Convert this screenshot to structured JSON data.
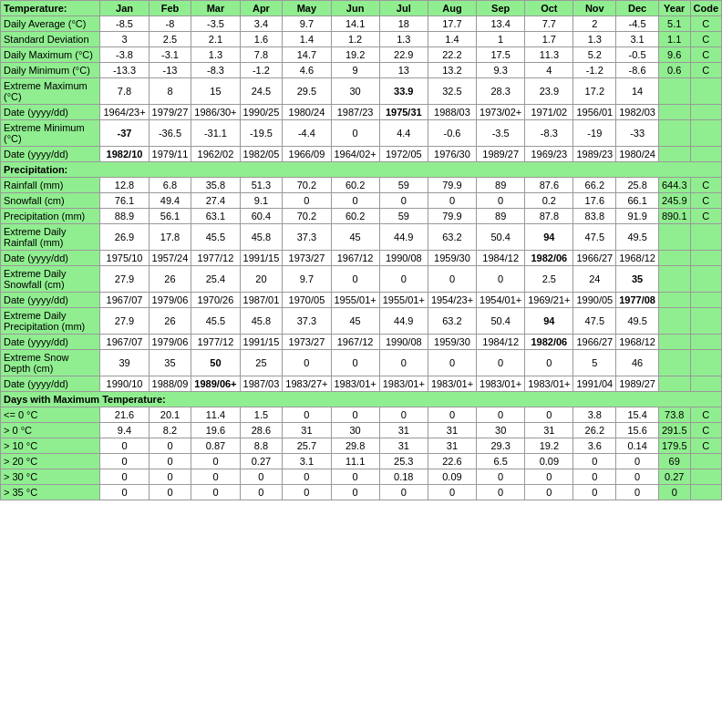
{
  "table": {
    "headers": [
      "Temperature:",
      "Jan",
      "Feb",
      "Mar",
      "Apr",
      "May",
      "Jun",
      "Jul",
      "Aug",
      "Sep",
      "Oct",
      "Nov",
      "Dec",
      "Year",
      "Code"
    ],
    "rows": [
      {
        "label": "Daily Average (°C)",
        "values": [
          "-8.5",
          "-8",
          "-3.5",
          "3.4",
          "9.7",
          "14.1",
          "18",
          "17.7",
          "13.4",
          "7.7",
          "2",
          "-4.5",
          "5.1",
          "C"
        ],
        "bold": []
      },
      {
        "label": "Standard Deviation",
        "values": [
          "3",
          "2.5",
          "2.1",
          "1.6",
          "1.4",
          "1.2",
          "1.3",
          "1.4",
          "1",
          "1.7",
          "1.3",
          "3.1",
          "1.1",
          "C"
        ],
        "bold": []
      },
      {
        "label": "Daily Maximum (°C)",
        "values": [
          "-3.8",
          "-3.1",
          "1.3",
          "7.8",
          "14.7",
          "19.2",
          "22.9",
          "22.2",
          "17.5",
          "11.3",
          "5.2",
          "-0.5",
          "9.6",
          "C"
        ],
        "bold": []
      },
      {
        "label": "Daily Minimum (°C)",
        "values": [
          "-13.3",
          "-13",
          "-8.3",
          "-1.2",
          "4.6",
          "9",
          "13",
          "13.2",
          "9.3",
          "4",
          "-1.2",
          "-8.6",
          "0.6",
          "C"
        ],
        "bold": []
      },
      {
        "label": "Extreme Maximum (°C)",
        "values": [
          "7.8",
          "8",
          "15",
          "24.5",
          "29.5",
          "30",
          "33.9",
          "32.5",
          "28.3",
          "23.9",
          "17.2",
          "14",
          "",
          ""
        ],
        "bold": [
          "33.9"
        ]
      },
      {
        "label": "Date (yyyy/dd)",
        "values": [
          "1964/23+",
          "1979/27",
          "1986/30+",
          "1990/25",
          "1980/24",
          "1987/23",
          "1975/31",
          "1988/03",
          "1973/02+",
          "1971/02",
          "1956/01",
          "1982/03",
          "",
          ""
        ],
        "bold": [
          "1975/31"
        ]
      },
      {
        "label": "Extreme Minimum (°C)",
        "values": [
          "-37",
          "-36.5",
          "-31.1",
          "-19.5",
          "-4.4",
          "0",
          "4.4",
          "-0.6",
          "-3.5",
          "-8.3",
          "-19",
          "-33",
          "",
          ""
        ],
        "bold": [
          "-37"
        ]
      },
      {
        "label": "Date (yyyy/dd)",
        "values": [
          "1982/10",
          "1979/11",
          "1962/02",
          "1982/05",
          "1966/09",
          "1964/02+",
          "1972/05",
          "1976/30",
          "1989/27",
          "1969/23",
          "1989/23",
          "1980/24",
          "",
          ""
        ],
        "bold": [
          "1982/10"
        ]
      },
      {
        "label": "Precipitation:",
        "section": true
      },
      {
        "label": "Rainfall (mm)",
        "values": [
          "12.8",
          "6.8",
          "35.8",
          "51.3",
          "70.2",
          "60.2",
          "59",
          "79.9",
          "89",
          "87.6",
          "66.2",
          "25.8",
          "644.3",
          "C"
        ],
        "bold": []
      },
      {
        "label": "Snowfall (cm)",
        "values": [
          "76.1",
          "49.4",
          "27.4",
          "9.1",
          "0",
          "0",
          "0",
          "0",
          "0",
          "0.2",
          "17.6",
          "66.1",
          "245.9",
          "C"
        ],
        "bold": []
      },
      {
        "label": "Precipitation (mm)",
        "values": [
          "88.9",
          "56.1",
          "63.1",
          "60.4",
          "70.2",
          "60.2",
          "59",
          "79.9",
          "89",
          "87.8",
          "83.8",
          "91.9",
          "890.1",
          "C"
        ],
        "bold": []
      },
      {
        "label": "Extreme Daily Rainfall (mm)",
        "values": [
          "26.9",
          "17.8",
          "45.5",
          "45.8",
          "37.3",
          "45",
          "44.9",
          "63.2",
          "50.4",
          "94",
          "47.5",
          "49.5",
          "",
          ""
        ],
        "bold": [
          "94"
        ]
      },
      {
        "label": "Date (yyyy/dd)",
        "values": [
          "1975/10",
          "1957/24",
          "1977/12",
          "1991/15",
          "1973/27",
          "1967/12",
          "1990/08",
          "1959/30",
          "1984/12",
          "1982/06",
          "1966/27",
          "1968/12",
          "",
          ""
        ],
        "bold": [
          "1982/06"
        ]
      },
      {
        "label": "Extreme Daily Snowfall (cm)",
        "values": [
          "27.9",
          "26",
          "25.4",
          "20",
          "9.7",
          "0",
          "0",
          "0",
          "0",
          "2.5",
          "24",
          "35",
          "",
          ""
        ],
        "bold": [
          "35"
        ]
      },
      {
        "label": "Date (yyyy/dd)",
        "values": [
          "1967/07",
          "1979/06",
          "1970/26",
          "1987/01",
          "1970/05",
          "1955/01+",
          "1955/01+",
          "1954/23+",
          "1954/01+",
          "1969/21+",
          "1990/05",
          "1977/08",
          "",
          ""
        ],
        "bold": [
          "1977/08"
        ]
      },
      {
        "label": "Extreme Daily Precipitation (mm)",
        "values": [
          "27.9",
          "26",
          "45.5",
          "45.8",
          "37.3",
          "45",
          "44.9",
          "63.2",
          "50.4",
          "94",
          "47.5",
          "49.5",
          "",
          ""
        ],
        "bold": [
          "94"
        ]
      },
      {
        "label": "Date (yyyy/dd)",
        "values": [
          "1967/07",
          "1979/06",
          "1977/12",
          "1991/15",
          "1973/27",
          "1967/12",
          "1990/08",
          "1959/30",
          "1984/12",
          "1982/06",
          "1966/27",
          "1968/12",
          "",
          ""
        ],
        "bold": [
          "1982/06"
        ]
      },
      {
        "label": "Extreme Snow Depth (cm)",
        "values": [
          "39",
          "35",
          "50",
          "25",
          "0",
          "0",
          "0",
          "0",
          "0",
          "0",
          "5",
          "46",
          "",
          ""
        ],
        "bold": [
          "50"
        ]
      },
      {
        "label": "Date (yyyy/dd)",
        "values": [
          "1990/10",
          "1988/09",
          "1989/06+",
          "1987/03",
          "1983/27+",
          "1983/01+",
          "1983/01+",
          "1983/01+",
          "1983/01+",
          "1983/01+",
          "1991/04",
          "1989/27",
          "",
          ""
        ],
        "bold": [
          "1989/06+"
        ]
      },
      {
        "label": "Days with Maximum Temperature:",
        "section": true
      },
      {
        "label": "<= 0 °C",
        "values": [
          "21.6",
          "20.1",
          "11.4",
          "1.5",
          "0",
          "0",
          "0",
          "0",
          "0",
          "0",
          "3.8",
          "15.4",
          "73.8",
          "C"
        ],
        "bold": []
      },
      {
        "label": "> 0 °C",
        "values": [
          "9.4",
          "8.2",
          "19.6",
          "28.6",
          "31",
          "30",
          "31",
          "31",
          "30",
          "31",
          "26.2",
          "15.6",
          "291.5",
          "C"
        ],
        "bold": []
      },
      {
        "label": "> 10 °C",
        "values": [
          "0",
          "0",
          "0.87",
          "8.8",
          "25.7",
          "29.8",
          "31",
          "31",
          "29.3",
          "19.2",
          "3.6",
          "0.14",
          "179.5",
          "C"
        ],
        "bold": []
      },
      {
        "label": "> 20 °C",
        "values": [
          "0",
          "0",
          "0",
          "0.27",
          "3.1",
          "11.1",
          "25.3",
          "22.6",
          "6.5",
          "0.09",
          "0",
          "0",
          "69",
          ""
        ],
        "bold": []
      },
      {
        "label": "> 30 °C",
        "values": [
          "0",
          "0",
          "0",
          "0",
          "0",
          "0",
          "0.18",
          "0.09",
          "0",
          "0",
          "0",
          "0",
          "0.27",
          ""
        ],
        "bold": []
      },
      {
        "label": "> 35 °C",
        "values": [
          "0",
          "0",
          "0",
          "0",
          "0",
          "0",
          "0",
          "0",
          "0",
          "0",
          "0",
          "0",
          "0",
          ""
        ],
        "bold": []
      }
    ]
  }
}
